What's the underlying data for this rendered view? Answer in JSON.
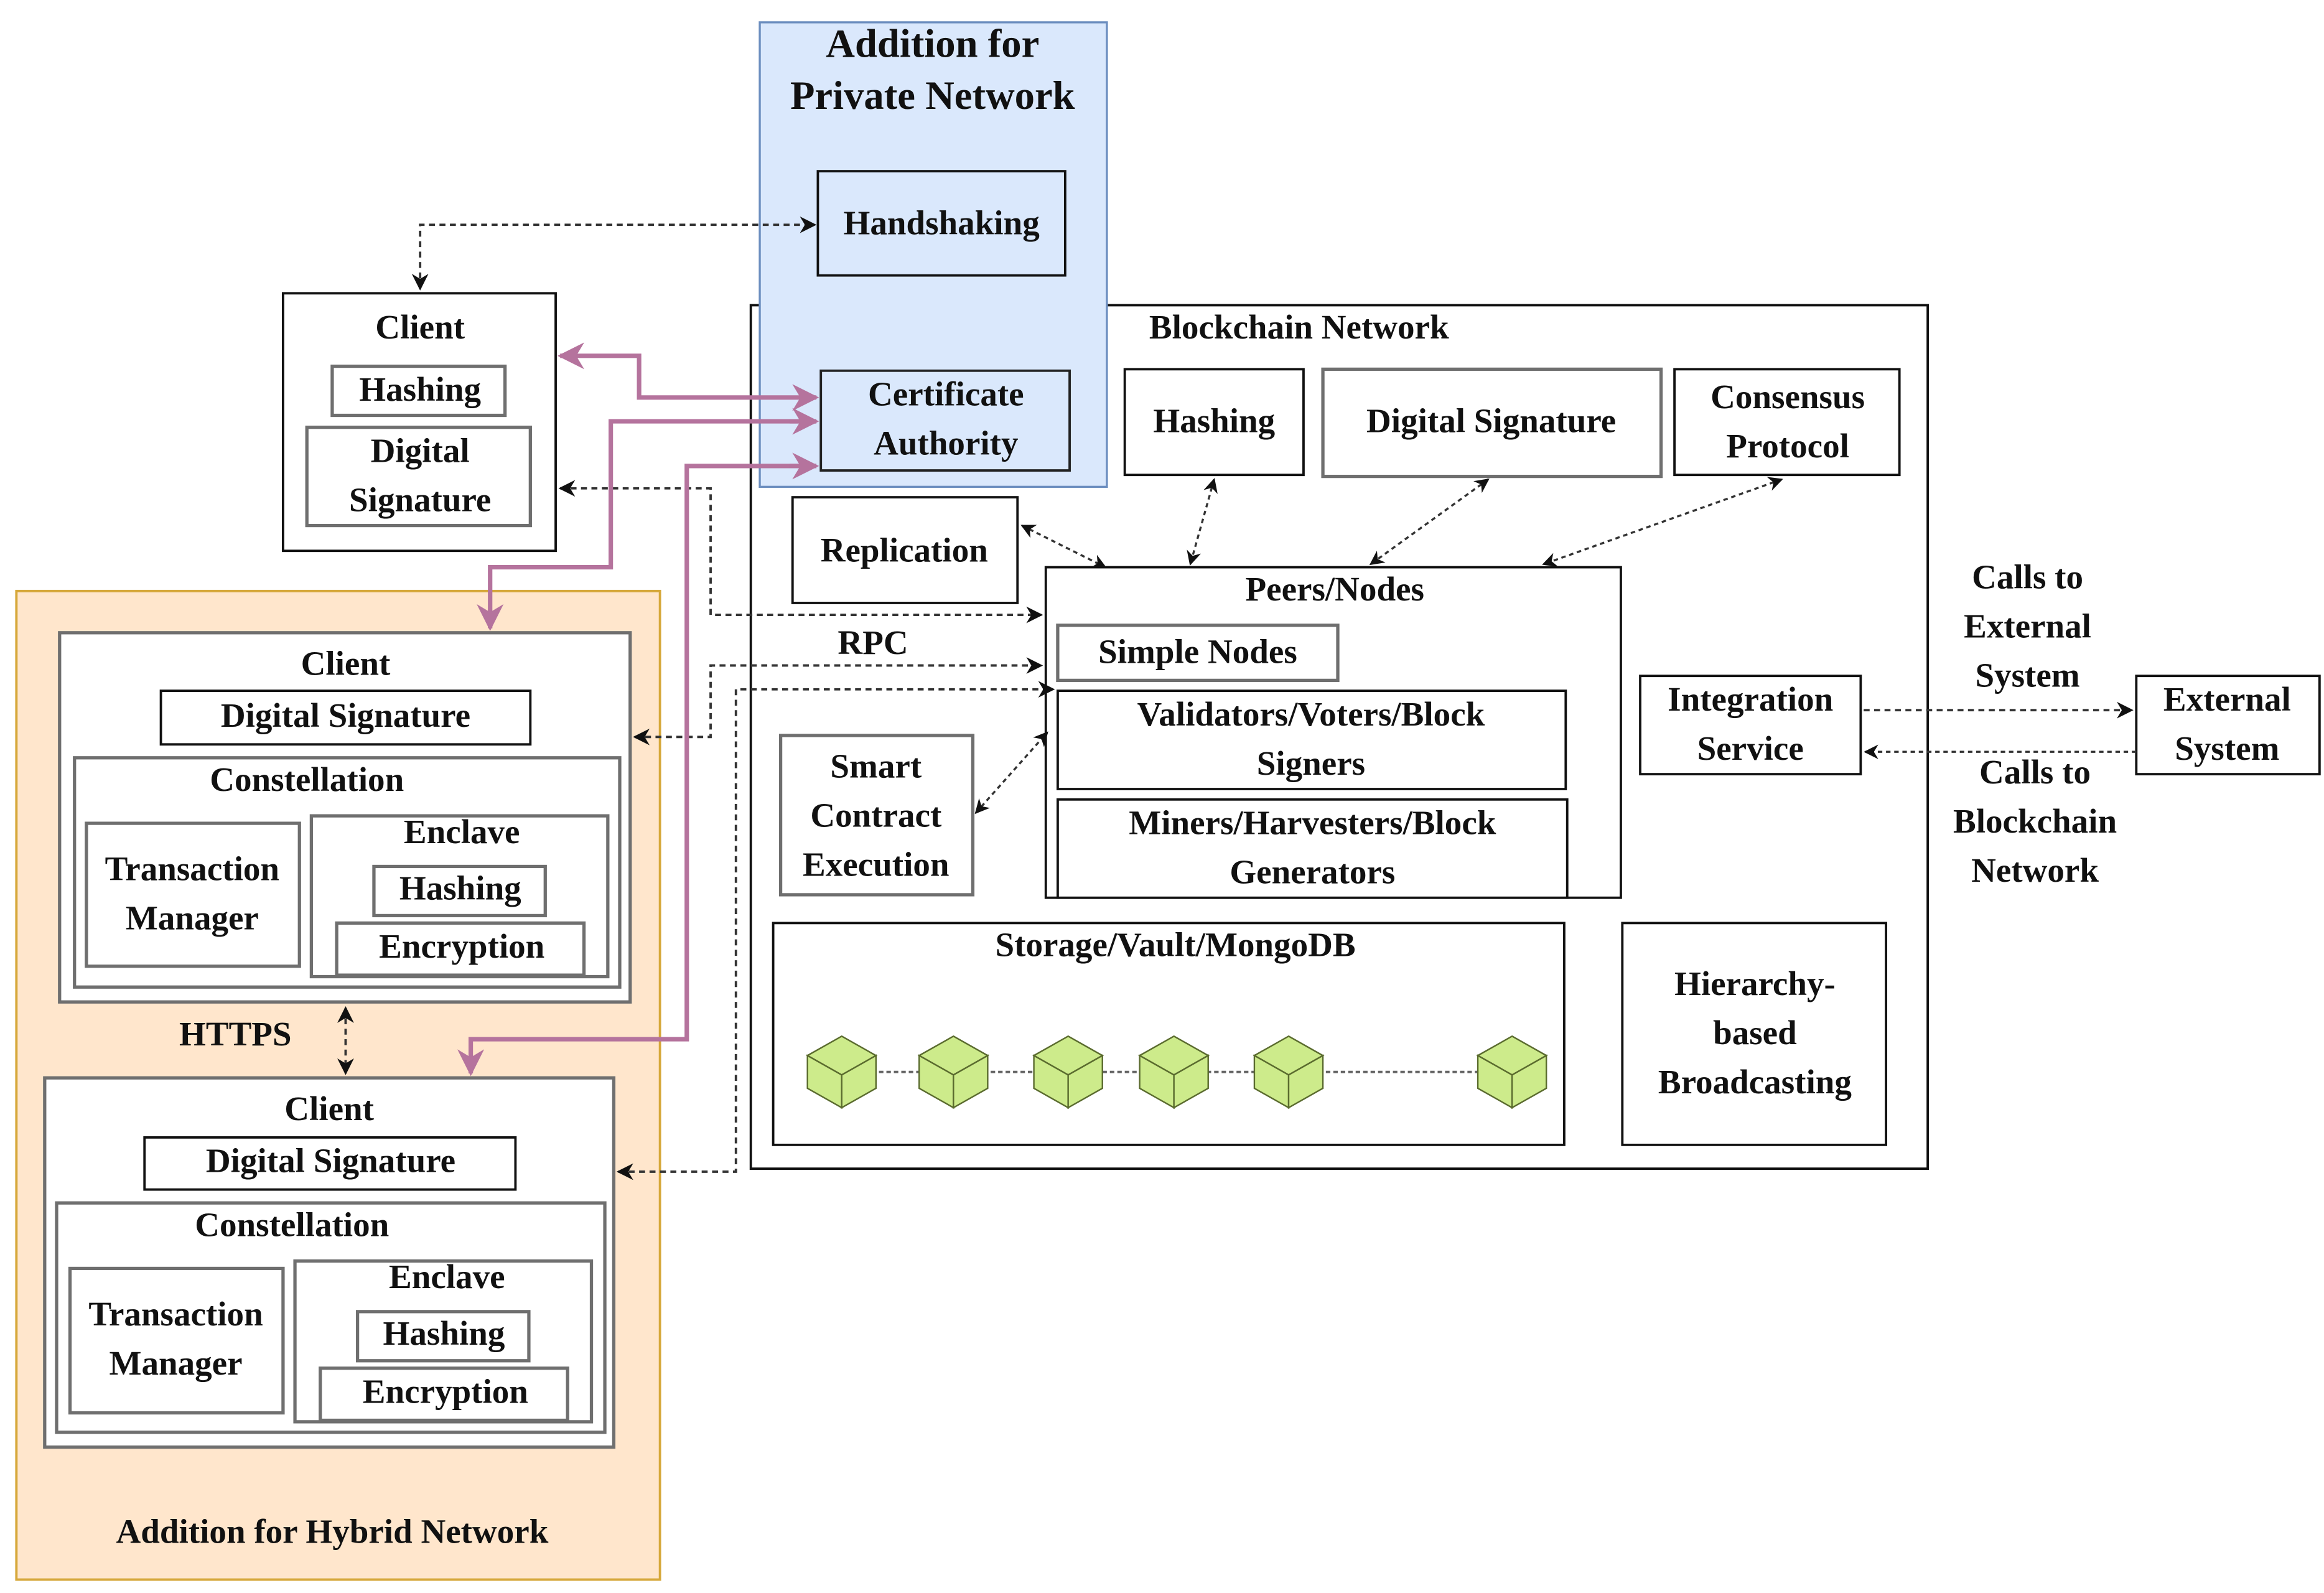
{
  "diagram": {
    "private_network": {
      "title_line1": "Addition for",
      "title_line2": "Private Network",
      "handshaking": "Handshaking",
      "certificate_authority_line1": "Certificate",
      "certificate_authority_line2": "Authority",
      "colors": {
        "fill": "#dae8fc",
        "border": "#6c8ebf"
      }
    },
    "client_top": {
      "title": "Client",
      "hashing": "Hashing",
      "digital_signature_line1": "Digital",
      "digital_signature_line2": "Signature"
    },
    "hybrid_network": {
      "title": "Addition for Hybrid Network",
      "colors": {
        "fill": "#ffe6cc",
        "border": "#d6a83a"
      },
      "https_label": "HTTPS",
      "clients": [
        {
          "title": "Client",
          "digital_signature": "Digital Signature",
          "constellation": "Constellation",
          "transaction_manager_line1": "Transaction",
          "transaction_manager_line2": "Manager",
          "enclave": "Enclave",
          "hashing": "Hashing",
          "encryption": "Encryption"
        },
        {
          "title": "Client",
          "digital_signature": "Digital Signature",
          "constellation": "Constellation",
          "transaction_manager_line1": "Transaction",
          "transaction_manager_line2": "Manager",
          "enclave": "Enclave",
          "hashing": "Hashing",
          "encryption": "Encryption"
        }
      ]
    },
    "blockchain_network": {
      "title": "Blockchain Network",
      "hashing": "Hashing",
      "digital_signature": "Digital Signature",
      "consensus_line1": "Consensus",
      "consensus_line2": "Protocol",
      "replication": "Replication",
      "rpc_label": "RPC",
      "peers": {
        "title": "Peers/Nodes",
        "simple_nodes": "Simple Nodes",
        "validators_line1": "Validators/Voters/Block",
        "validators_line2": "Signers",
        "miners_line1": "Miners/Harvesters/Block",
        "miners_line2": "Generators"
      },
      "smart_contract_line1": "Smart",
      "smart_contract_line2": "Contract",
      "smart_contract_line3": "Execution",
      "storage": "Storage/Vault/MongoDB",
      "storage_block_count": 6,
      "hierarchy_line1": "Hierarchy-",
      "hierarchy_line2": "based",
      "hierarchy_line3": "Broadcasting",
      "integration_line1": "Integration",
      "integration_line2": "Service",
      "block_color": "#cdeb8b"
    },
    "external": {
      "system_line1": "External",
      "system_line2": "System",
      "calls_to_external_line1": "Calls to",
      "calls_to_external_line2": "External",
      "calls_to_external_line3": "System",
      "calls_to_blockchain_line1": "Calls to",
      "calls_to_blockchain_line2": "Blockchain",
      "calls_to_blockchain_line3": "Network"
    },
    "connector_colors": {
      "certificate_links": "#b5739d",
      "dashed_links": "#333333"
    }
  }
}
